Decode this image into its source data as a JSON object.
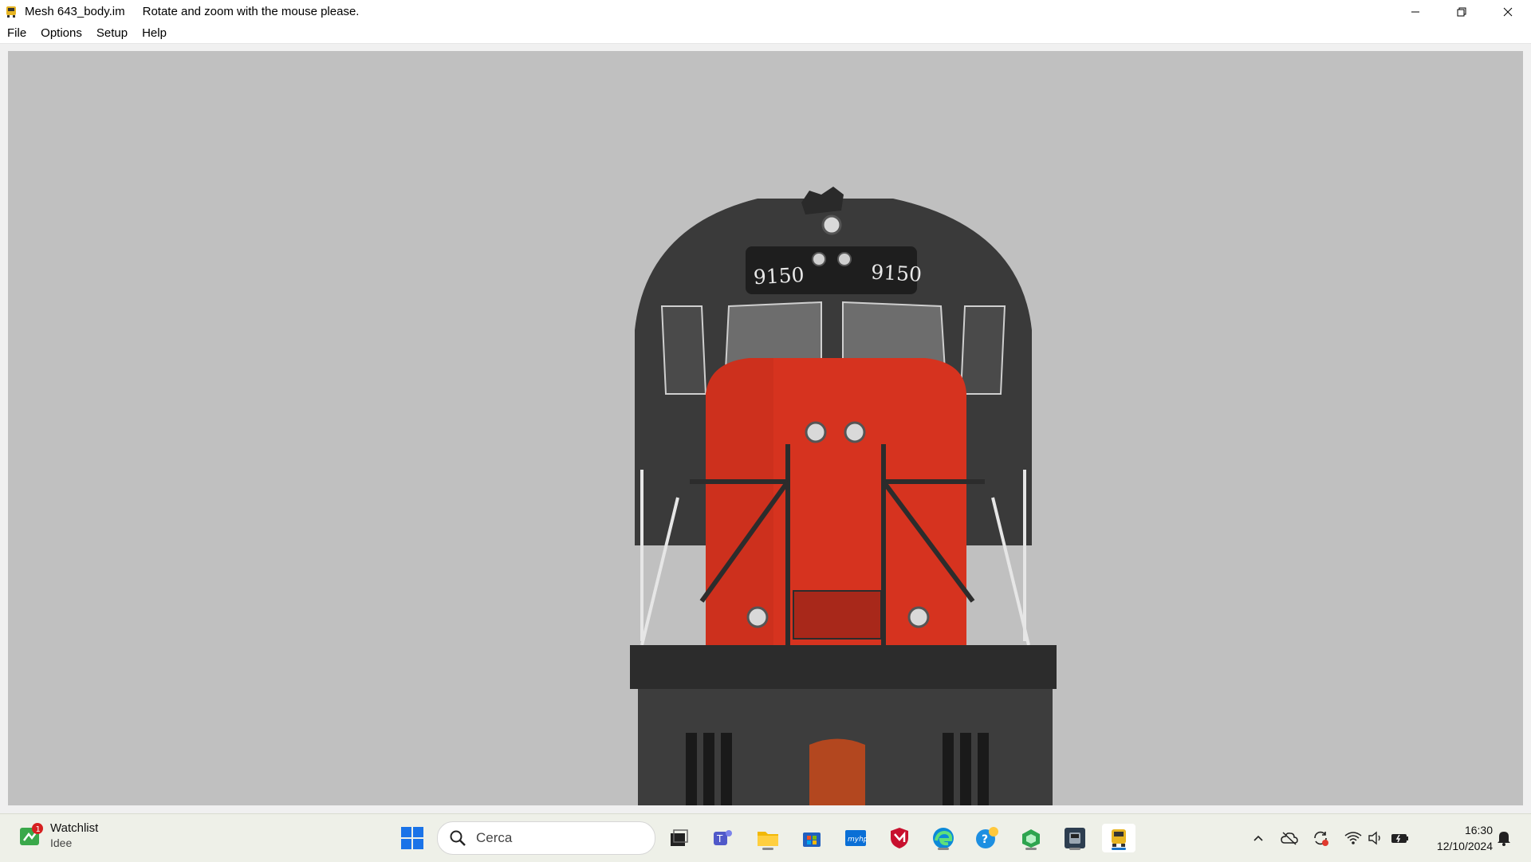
{
  "window": {
    "file_name": "Mesh 643_body.im",
    "hint": "Rotate and zoom with the mouse please."
  },
  "menu": [
    "File",
    "Options",
    "Setup",
    "Help"
  ],
  "model": {
    "number_left": "9150",
    "number_right": "9150",
    "body_color": "#3a3a3a",
    "hood_color": "#d6331f",
    "background": "#c0c0c0"
  },
  "taskbar": {
    "widget_title": "Watchlist",
    "widget_subtitle": "Idee",
    "widget_badge": "1",
    "search_placeholder": "Cerca",
    "time": "16:30",
    "date": "12/10/2024",
    "apps": [
      "start-icon",
      "task-view-icon",
      "teams-icon",
      "file-explorer-icon",
      "store-icon",
      "myhp-icon",
      "mcafee-icon",
      "edge-icon",
      "help-icon",
      "app-green-icon",
      "train-sim-icon",
      "mesh-viewer-icon"
    ]
  }
}
